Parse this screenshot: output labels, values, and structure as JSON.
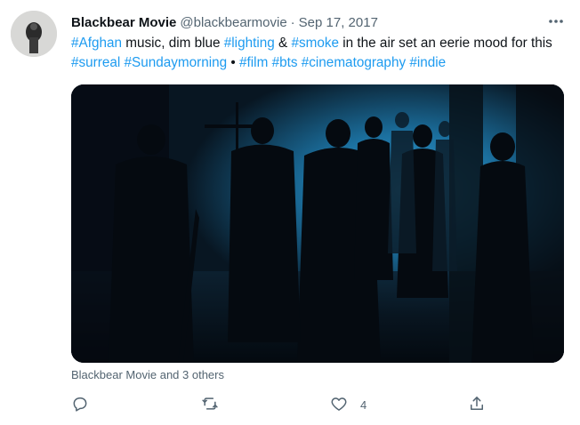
{
  "tweet": {
    "author_name": "Blackbear Movie",
    "handle": "@blackbearmovie",
    "separator": "·",
    "date": "Sep 17, 2017",
    "avatar_icon": "avatar-photo",
    "more_icon": "more-dots-icon",
    "text_segments": [
      {
        "text": "#Afghan",
        "type": "hashtag"
      },
      {
        "text": " music, dim blue ",
        "type": "plain"
      },
      {
        "text": "#lighting",
        "type": "hashtag"
      },
      {
        "text": " & ",
        "type": "plain"
      },
      {
        "text": "#smoke",
        "type": "hashtag"
      },
      {
        "text": " in the air set an eerie mood for this ",
        "type": "plain"
      },
      {
        "text": "#surreal",
        "type": "hashtag"
      },
      {
        "text": " ",
        "type": "plain"
      },
      {
        "text": "#Sundaymorning",
        "type": "hashtag"
      },
      {
        "text": " • ",
        "type": "plain"
      },
      {
        "text": "#film",
        "type": "hashtag"
      },
      {
        "text": " ",
        "type": "plain"
      },
      {
        "text": "#bts",
        "type": "hashtag"
      },
      {
        "text": " ",
        "type": "plain"
      },
      {
        "text": "#cinematography",
        "type": "hashtag"
      },
      {
        "text": " ",
        "type": "plain"
      },
      {
        "text": "#indie",
        "type": "hashtag"
      }
    ],
    "media": {
      "kind": "photo",
      "dominant_color": "#1f7fb4"
    },
    "liked_by": "Blackbear Movie and 3 others",
    "actions": {
      "reply_icon": "reply-icon",
      "retweet_icon": "retweet-icon",
      "like_icon": "heart-icon",
      "like_count": "4",
      "share_icon": "share-icon"
    }
  },
  "colors": {
    "link": "#1d9bf0",
    "secondary": "#536471",
    "text": "#0f1419"
  }
}
